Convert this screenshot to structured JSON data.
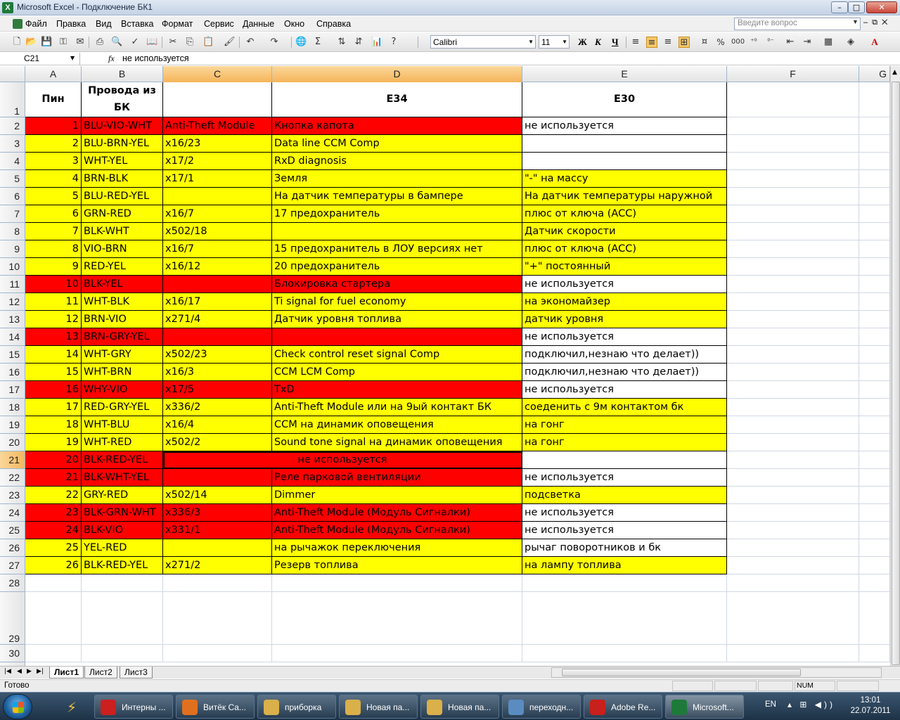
{
  "window": {
    "title": "Microsoft Excel - Подключение БК1",
    "app_icon": "excel-icon"
  },
  "menu": {
    "items": [
      "Файл",
      "Правка",
      "Вид",
      "Вставка",
      "Формат",
      "Сервис",
      "Данные",
      "Окно",
      "Справка"
    ],
    "ask_placeholder": "Введите вопрос"
  },
  "toolbar": {
    "font": "Calibri",
    "size": "11",
    "bold": "Ж",
    "italic": "К",
    "underline": "Ч",
    "percent": "%",
    "thousands": "000"
  },
  "formula_bar": {
    "cell_ref": "C21",
    "fx": "fx",
    "value": "не используется"
  },
  "columns": [
    "A",
    "B",
    "C",
    "D",
    "E",
    "F",
    "G"
  ],
  "rows": [
    "1",
    "2",
    "3",
    "4",
    "5",
    "6",
    "7",
    "8",
    "9",
    "10",
    "11",
    "12",
    "13",
    "14",
    "15",
    "16",
    "17",
    "18",
    "19",
    "20",
    "21",
    "22",
    "23",
    "24",
    "25",
    "26",
    "27",
    "28",
    "29",
    "30"
  ],
  "header_row": {
    "a": "Пин",
    "b": "Провода из БК",
    "c": "",
    "d": "E34",
    "e": "E30"
  },
  "table": [
    {
      "pin": "1",
      "wire": "BLU-VIO-WHT",
      "conn": "Anti-Theft Module",
      "e34": "Кнопка капота",
      "e30": "не используется",
      "fill": "red",
      "e_fill": "white"
    },
    {
      "pin": "2",
      "wire": "BLU-BRN-YEL",
      "conn": "x16/23",
      "e34": "Data line CCM Comp",
      "e30": "",
      "fill": "yellow",
      "e_fill": "white"
    },
    {
      "pin": "3",
      "wire": "WHT-YEL",
      "conn": "x17/2",
      "e34": "RxD diagnosis",
      "e30": "",
      "fill": "yellow",
      "e_fill": "white"
    },
    {
      "pin": "4",
      "wire": "BRN-BLK",
      "conn": "x17/1",
      "e34": "Земля",
      "e30": "\"-\" на массу",
      "fill": "yellow",
      "e_fill": "yellow"
    },
    {
      "pin": "5",
      "wire": "BLU-RED-YEL",
      "conn": "",
      "e34": "На датчик температуры в бампере",
      "e30": "На датчик температуры наружной",
      "fill": "yellow",
      "e_fill": "yellow"
    },
    {
      "pin": "6",
      "wire": "GRN-RED",
      "conn": "x16/7",
      "e34": "17 предохранитель",
      "e30": "плюс от ключа (ACC)",
      "fill": "yellow",
      "e_fill": "yellow"
    },
    {
      "pin": "7",
      "wire": "BLK-WHT",
      "conn": "x502/18",
      "e34": "",
      "e30": "Датчик скорости",
      "fill": "yellow",
      "e_fill": "yellow"
    },
    {
      "pin": "8",
      "wire": "VIO-BRN",
      "conn": "x16/7",
      "e34": "15 предохранитель в ЛОУ версиях нет",
      "e30": "плюс от ключа (ACC)",
      "fill": "yellow",
      "e_fill": "yellow"
    },
    {
      "pin": "9",
      "wire": "RED-YEL",
      "conn": "x16/12",
      "e34": "20 предохранитель",
      "e30": "\"+\"  постоянный",
      "fill": "yellow",
      "e_fill": "yellow"
    },
    {
      "pin": "10",
      "wire": "BLK-YEL",
      "conn": "",
      "e34": "Блокировка стартера",
      "e30": "не используется",
      "fill": "red",
      "e_fill": "white"
    },
    {
      "pin": "11",
      "wire": "WHT-BLK",
      "conn": "x16/17",
      "e34": "Ti signal for fuel economy",
      "e30": "на экономайзер",
      "fill": "yellow",
      "e_fill": "yellow"
    },
    {
      "pin": "12",
      "wire": "BRN-VIO",
      "conn": "x271/4",
      "e34": "Датчик уровня топлива",
      "e30": "датчик уровня",
      "fill": "yellow",
      "e_fill": "yellow"
    },
    {
      "pin": "13",
      "wire": "BRN-GRY-YEL",
      "conn": "",
      "e34": "",
      "e30": "не используется",
      "fill": "red",
      "e_fill": "white"
    },
    {
      "pin": "14",
      "wire": "WHT-GRY",
      "conn": "x502/23",
      "e34": "Check control reset signal Comp",
      "e30": "подключил,незнаю что делает))",
      "fill": "yellow",
      "e_fill": "white"
    },
    {
      "pin": "15",
      "wire": "WHT-BRN",
      "conn": "x16/3",
      "e34": "CCM LCM Comp",
      "e30": "подключил,незнаю что делает))",
      "fill": "yellow",
      "e_fill": "white"
    },
    {
      "pin": "16",
      "wire": "WHY-VIO",
      "conn": "x17/5",
      "e34": "TxD",
      "e30": "не используется",
      "fill": "red",
      "e_fill": "white"
    },
    {
      "pin": "17",
      "wire": "RED-GRY-YEL",
      "conn": "x336/2",
      "e34": "Anti-Theft Module или на 9ый контакт БК",
      "e30": "соеденить с 9м контактом бк",
      "fill": "yellow",
      "e_fill": "yellow"
    },
    {
      "pin": "18",
      "wire": "WHT-BLU",
      "conn": "x16/4",
      "e34": "CCM на динамик оповещения",
      "e30": "на гонг",
      "fill": "yellow",
      "e_fill": "yellow"
    },
    {
      "pin": "19",
      "wire": "WHT-RED",
      "conn": "x502/2",
      "e34": "Sound tone signal на динамик оповещения",
      "e30": "на гонг",
      "fill": "yellow",
      "e_fill": "yellow"
    },
    {
      "pin": "20",
      "wire": "BLK-RED-YEL",
      "conn": "не используется",
      "e34": "",
      "e30": "",
      "fill": "red",
      "e_fill": "white",
      "merged": true
    },
    {
      "pin": "21",
      "wire": "BLK-WHT-YEL",
      "conn": "",
      "e34": "Реле парковой вентиляции",
      "e30": "не используется",
      "fill": "red",
      "e_fill": "white"
    },
    {
      "pin": "22",
      "wire": "GRY-RED",
      "conn": "x502/14",
      "e34": "Dimmer",
      "e30": "подсветка",
      "fill": "yellow",
      "e_fill": "yellow"
    },
    {
      "pin": "23",
      "wire": "BLK-GRN-WHT",
      "conn": "x336/3",
      "e34": "Anti-Theft Module (Модуль Сигналки)",
      "e30": "не используется",
      "fill": "red",
      "e_fill": "white"
    },
    {
      "pin": "24",
      "wire": "BLK-VIO",
      "conn": "x331/1",
      "e34": "Anti-Theft Module (Модуль Сигналки)",
      "e30": "не используется",
      "fill": "red",
      "e_fill": "white"
    },
    {
      "pin": "25",
      "wire": "YEL-RED",
      "conn": "",
      "e34": "на рычажок переключения",
      "e30": "рычаг поворотников и бк",
      "fill": "yellow",
      "e_fill": "white"
    },
    {
      "pin": "26",
      "wire": "BLK-RED-YEL",
      "conn": "x271/2",
      "e34": "Резерв топлива",
      "e30": "на лампу топлива",
      "fill": "yellow",
      "e_fill": "yellow"
    }
  ],
  "sheet_tabs": [
    "Лист1",
    "Лист2",
    "Лист3"
  ],
  "status": {
    "text": "Готово",
    "num": "NUM"
  },
  "taskbar": {
    "items": [
      {
        "label": "Интерны ...",
        "icon": "opera-icon",
        "color": "#cc1f1f"
      },
      {
        "label": "Витёк Са...",
        "icon": "firefox-icon",
        "color": "#e07020"
      },
      {
        "label": "приборка",
        "icon": "folder-icon",
        "color": "#d9b04a"
      },
      {
        "label": "Новая па...",
        "icon": "folder-icon",
        "color": "#d9b04a"
      },
      {
        "label": "Новая па...",
        "icon": "folder-icon",
        "color": "#d9b04a"
      },
      {
        "label": "переходн...",
        "icon": "image-viewer-icon",
        "color": "#5a8cc0"
      },
      {
        "label": "Adobe Re...",
        "icon": "adobe-reader-icon",
        "color": "#c8201c"
      },
      {
        "label": "Microsoft...",
        "icon": "excel-icon",
        "color": "#1e7a3a"
      }
    ],
    "lang": "EN",
    "time": "13:01",
    "date": "22.07.2011"
  },
  "colors": {
    "red": "#ff0000",
    "yellow": "#ffff00",
    "selection_header": "#f5b45a"
  }
}
